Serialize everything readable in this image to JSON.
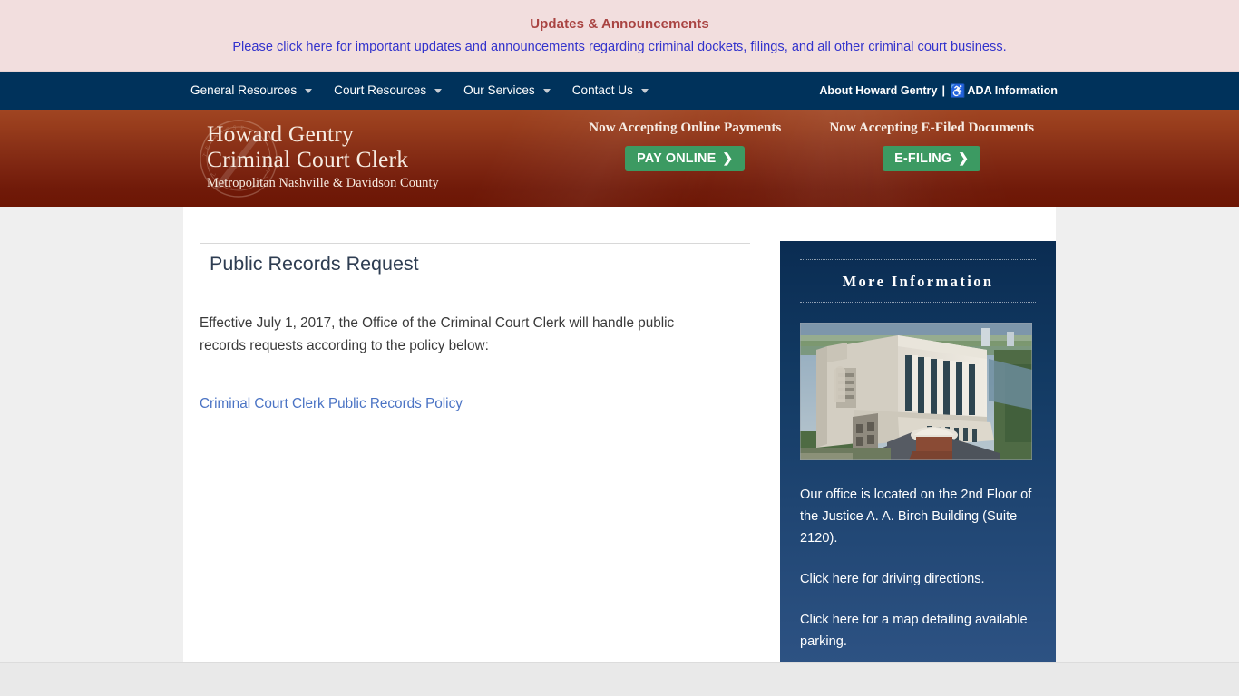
{
  "announcement": {
    "title": "Updates & Announcements",
    "link_text": "Please click here for important updates and announcements regarding criminal dockets, filings, and all other criminal court business.",
    "title_color": "#a94442",
    "link_color": "#3333cc",
    "background": "#f2dede"
  },
  "nav": {
    "background": "#00325b",
    "items": [
      {
        "label": "General Resources",
        "has_dropdown": true
      },
      {
        "label": "Court Resources",
        "has_dropdown": true
      },
      {
        "label": "Our Services",
        "has_dropdown": true
      },
      {
        "label": "Contact Us",
        "has_dropdown": true
      }
    ],
    "right": {
      "about_label": "About Howard Gentry",
      "separator": "|",
      "ada_icon": "wheelchair-accessibility-icon",
      "ada_glyph": "♿",
      "ada_label": "ADA Information"
    }
  },
  "masthead": {
    "seal_icon": "court-clerk-seal-watermark",
    "brand_line1": "Howard Gentry",
    "brand_line2": "Criminal Court Clerk",
    "brand_sub": "Metropolitan Nashville & Davidson County",
    "promos": [
      {
        "label": "Now Accepting Online Payments",
        "button_label": "PAY ONLINE",
        "button_chevron": "❯",
        "button_color": "#3c9a62"
      },
      {
        "label": "Now Accepting E-Filed Documents",
        "button_label": "E-FILING",
        "button_chevron": "❯",
        "button_color": "#3c9a62"
      }
    ]
  },
  "main": {
    "page_title": "Public Records Request",
    "body_paragraph": "Effective July 1, 2017, the Office of the Criminal Court Clerk will handle public records requests according to the policy below:",
    "policy_link": "Criminal Court Clerk Public Records Policy",
    "link_color": "#4a73c4"
  },
  "sidebar": {
    "title": "More Information",
    "photo_icon": "justice-ab-birch-building-photo",
    "paragraphs": [
      "Our office is located on the 2nd Floor of the Justice A. A. Birch Building (Suite 2120).",
      "Click here for driving directions.",
      "Click here for a map detailing available parking."
    ],
    "gradient_top": "#0a2c52",
    "gradient_bottom": "#2d5283"
  }
}
